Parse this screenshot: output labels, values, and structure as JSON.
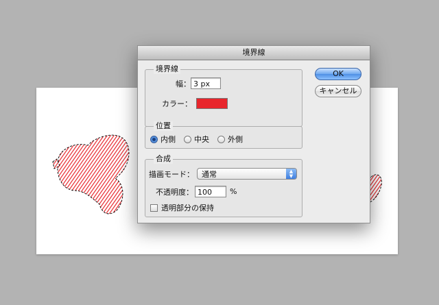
{
  "dialog": {
    "title": "境界線",
    "stroke_group": {
      "label": "境界線",
      "width_label": "幅：",
      "width_value": "3 px",
      "color_label": "カラー：",
      "color_value": "#e8262c"
    },
    "location_group": {
      "label": "位置",
      "options": [
        "内側",
        "中央",
        "外側"
      ],
      "selected": "内側"
    },
    "blending_group": {
      "label": "合成",
      "mode_label": "描画モード：",
      "mode_value": "通常",
      "opacity_label": "不透明度：",
      "opacity_value": "100",
      "opacity_unit": "%",
      "preserve_label": "透明部分の保持",
      "preserve_checked": false
    },
    "buttons": {
      "ok": "OK",
      "cancel": "キャンセル"
    }
  },
  "colors": {
    "background": "#b3b3b3",
    "canvas": "#ffffff",
    "stroke_red": "#e8262c",
    "ok_blue": "#5a96e8"
  },
  "icons": {
    "radio": "radio-button",
    "checkbox": "checkbox",
    "select_arrows": "up-down-arrows-icon"
  }
}
